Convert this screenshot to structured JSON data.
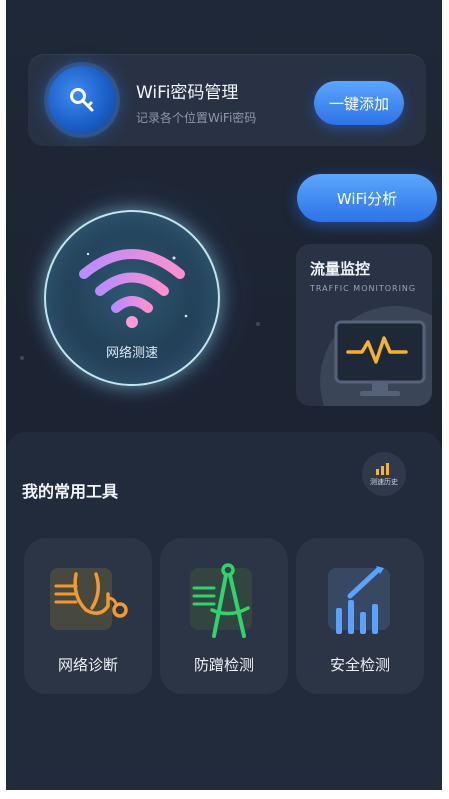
{
  "password_card": {
    "title": "WiFi密码管理",
    "subtitle": "记录各个位置WiFi密码",
    "add_button": "一键添加",
    "icon": "key-icon"
  },
  "wifi_analysis_button": "WiFi分析",
  "speed_test": {
    "label": "网络测速",
    "icon": "wifi-icon"
  },
  "traffic_card": {
    "title": "流量监控",
    "subtitle": "TRAFFIC MONITORING",
    "icon": "monitor-icon"
  },
  "tools": {
    "title": "我的常用工具",
    "history_label": "测速历史",
    "items": [
      {
        "label": "网络诊断",
        "icon": "stethoscope-icon"
      },
      {
        "label": "防蹭检测",
        "icon": "compass-icon"
      },
      {
        "label": "安全检测",
        "icon": "bar-chart-icon"
      }
    ]
  },
  "colors": {
    "background": "#1f2838",
    "card": "#283244",
    "accent_blue": "#2d73e6",
    "orange": "#f29a2e",
    "green": "#2fd46a",
    "light_blue": "#5aa2ff"
  }
}
